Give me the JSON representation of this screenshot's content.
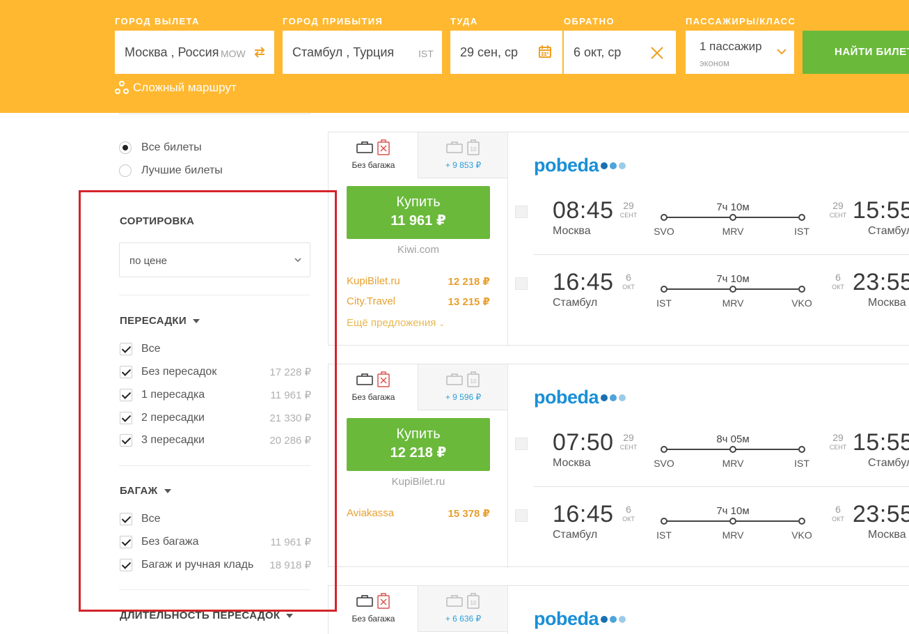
{
  "header": {
    "from_label": "ГОРОД ВЫЛЕТА",
    "to_label": "ГОРОД ПРИБЫТИЯ",
    "depart_label": "ТУДА",
    "return_label": "ОБРАТНО",
    "pax_label": "ПАССАЖИРЫ/КЛАСС",
    "from_value": "Москва , Россия",
    "from_code": "MOW",
    "to_value": "Стамбул , Турция",
    "to_code": "IST",
    "depart_value": "29 сен, ср",
    "return_value": "6 окт, ср",
    "pax_value": "1 пассажир",
    "class_value": "эконом",
    "search_button": "НАЙТИ БИЛЕТЫ",
    "complex_route": "Сложный маршрут",
    "accent_color": "#ffb830"
  },
  "sidebar": {
    "view_options": [
      {
        "label": "Все билеты",
        "selected": true
      },
      {
        "label": "Лучшие билеты",
        "selected": false
      }
    ],
    "sort": {
      "title": "СОРТИРОВКА",
      "value": "по цене"
    },
    "transfers": {
      "title": "ПЕРЕСАДКИ",
      "items": [
        {
          "label": "Все",
          "price": ""
        },
        {
          "label": "Без пересадок",
          "price": "17 228 ₽"
        },
        {
          "label": "1 пересадка",
          "price": "11 961 ₽"
        },
        {
          "label": "2 пересадки",
          "price": "21 330 ₽"
        },
        {
          "label": "3 пересадки",
          "price": "20 286 ₽"
        }
      ]
    },
    "baggage": {
      "title": "БАГАЖ",
      "items": [
        {
          "label": "Все",
          "price": ""
        },
        {
          "label": "Без багажа",
          "price": "11 961 ₽"
        },
        {
          "label": "Багаж и ручная кладь",
          "price": "18 918 ₽"
        }
      ]
    },
    "duration_title": "ДЛИТЕЛЬНОСТЬ ПЕРЕСАДОК"
  },
  "tickets": [
    {
      "tab_no_bag": "Без багажа",
      "tab_bag_extra": "+ 9 853 ₽",
      "buy_label": "Купить",
      "price": "11 961 ₽",
      "agent": "Kiwi.com",
      "offers": [
        {
          "name": "KupiBilet.ru",
          "price": "12 218 ₽"
        },
        {
          "name": "City.Travel",
          "price": "13 215 ₽"
        }
      ],
      "more_offers": "Ещё предложения",
      "airline": "pobeda",
      "legs": [
        {
          "dep_time": "08:45",
          "dep_day": "29",
          "dep_mon": "СЕНТ",
          "dep_city": "Москва",
          "duration": "7ч 10м",
          "stops": [
            "SVO",
            "MRV",
            "IST"
          ],
          "arr_day": "29",
          "arr_mon": "СЕНТ",
          "arr_time": "15:55",
          "arr_city": "Стамбул"
        },
        {
          "dep_time": "16:45",
          "dep_day": "6",
          "dep_mon": "ОКТ",
          "dep_city": "Стамбул",
          "duration": "7ч 10м",
          "stops": [
            "IST",
            "MRV",
            "VKO"
          ],
          "arr_day": "6",
          "arr_mon": "ОКТ",
          "arr_time": "23:55",
          "arr_city": "Москва"
        }
      ]
    },
    {
      "tab_no_bag": "Без багажа",
      "tab_bag_extra": "+ 9 596 ₽",
      "buy_label": "Купить",
      "price": "12 218 ₽",
      "agent": "KupiBilet.ru",
      "offers": [
        {
          "name": "Aviakassa",
          "price": "15 378 ₽"
        }
      ],
      "airline": "pobeda",
      "legs": [
        {
          "dep_time": "07:50",
          "dep_day": "29",
          "dep_mon": "СЕНТ",
          "dep_city": "Москва",
          "duration": "8ч 05м",
          "stops": [
            "SVO",
            "MRV",
            "IST"
          ],
          "arr_day": "29",
          "arr_mon": "СЕНТ",
          "arr_time": "15:55",
          "arr_city": "Стамбул"
        },
        {
          "dep_time": "16:45",
          "dep_day": "6",
          "dep_mon": "ОКТ",
          "dep_city": "Стамбул",
          "duration": "7ч 10м",
          "stops": [
            "IST",
            "MRV",
            "VKO"
          ],
          "arr_day": "6",
          "arr_mon": "ОКТ",
          "arr_time": "23:55",
          "arr_city": "Москва"
        }
      ]
    },
    {
      "tab_no_bag": "Без багажа",
      "tab_bag_extra": "+ 6 636 ₽",
      "airline": "pobeda"
    }
  ]
}
